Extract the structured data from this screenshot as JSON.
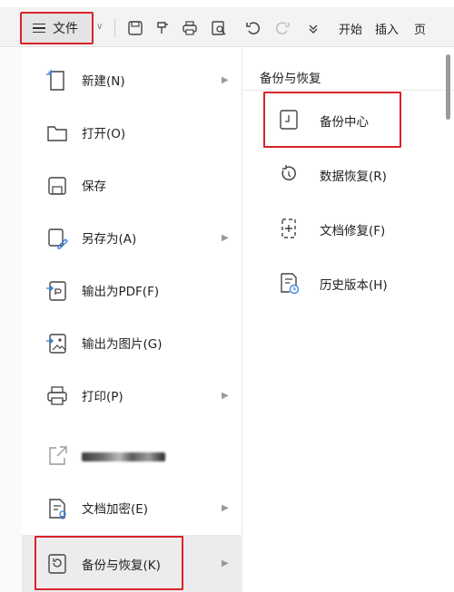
{
  "toolbar": {
    "file_label": "文件",
    "start_tab": "开始",
    "insert_tab": "插入",
    "page_tab_partial": "页"
  },
  "menu": {
    "items": [
      {
        "label": "新建(N)",
        "icon": "new-file-icon",
        "has_submenu": true
      },
      {
        "label": "打开(O)",
        "icon": "folder-icon",
        "has_submenu": false
      },
      {
        "label": "保存",
        "icon": "save-icon",
        "has_submenu": false
      },
      {
        "label": "另存为(A)",
        "icon": "save-as-icon",
        "has_submenu": true
      },
      {
        "label": "输出为PDF(F)",
        "icon": "pdf-export-icon",
        "has_submenu": false
      },
      {
        "label": "输出为图片(G)",
        "icon": "image-export-icon",
        "has_submenu": false
      },
      {
        "label": "打印(P)",
        "icon": "printer-icon",
        "has_submenu": true
      },
      {
        "label": "",
        "icon": "share-icon",
        "has_submenu": false
      },
      {
        "label": "文档加密(E)",
        "icon": "encrypt-icon",
        "has_submenu": true
      },
      {
        "label": "备份与恢复(K)",
        "icon": "backup-icon",
        "has_submenu": true
      }
    ]
  },
  "submenu": {
    "title": "备份与恢复",
    "items": [
      {
        "label": "备份中心",
        "icon": "backup-center-icon"
      },
      {
        "label": "数据恢复(R)",
        "icon": "data-recovery-icon"
      },
      {
        "label": "文档修复(F)",
        "icon": "document-repair-icon"
      },
      {
        "label": "历史版本(H)",
        "icon": "history-version-icon"
      }
    ]
  },
  "colors": {
    "highlight_border": "#d9242a",
    "accent_blue": "#2f7de1"
  }
}
